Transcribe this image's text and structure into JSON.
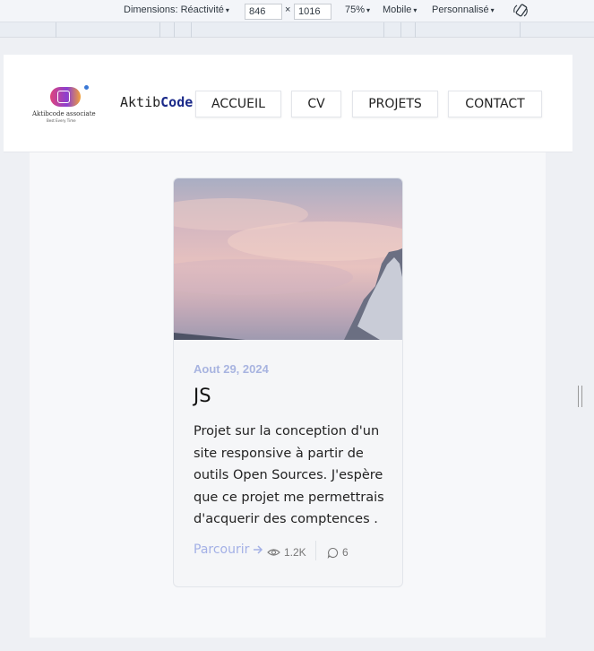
{
  "devtools": {
    "dimensions_label": "Dimensions: Réactivité",
    "width": "846",
    "times": "×",
    "height": "1016",
    "zoom": "75%",
    "throttle": "Mobile",
    "custom": "Personnalisé",
    "caret": "▾"
  },
  "site": {
    "logo_name": "Aktibcode associate",
    "logo_tagline": "Best Every Time",
    "brand_prefix": "Aktib",
    "brand_suffix": "Code",
    "nav": [
      "ACCUEIL",
      "CV",
      "PROJETS",
      "CONTACT"
    ]
  },
  "card": {
    "date": "Aout 29, 2024",
    "title": "JS",
    "description": "Projet sur la conception d'un site responsive à partir de outils Open Sources. J'espère que ce projet me permettrais d'acquerir des comptences .",
    "link_label": "Parcourir",
    "views": "1.2K",
    "comments": "6"
  },
  "colors": {
    "accent_link": "#a3b0e6",
    "date": "#a8b4e0",
    "brand_code": "#1b2a8a"
  }
}
